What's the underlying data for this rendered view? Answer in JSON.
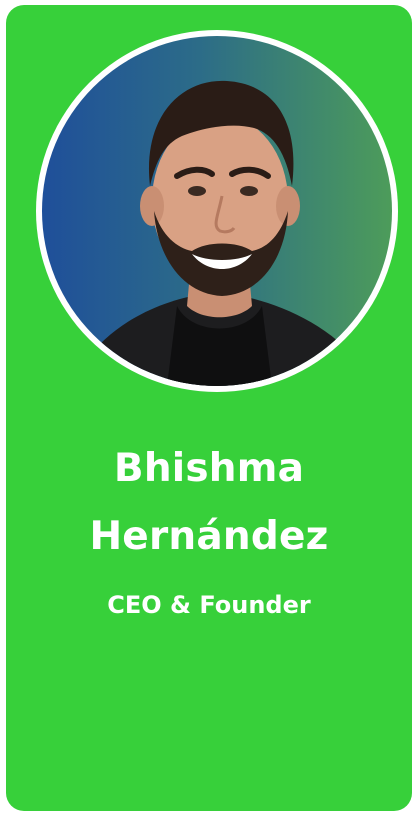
{
  "profile": {
    "first_name": "Bhishma",
    "last_name": "Hernández",
    "role": "CEO & Founder"
  },
  "colors": {
    "card_background": "#37d03a",
    "text": "#ffffff",
    "ring": "#ffffff",
    "photo_gradient_start": "#1f4f9a",
    "photo_gradient_end": "#4d9c5a"
  }
}
